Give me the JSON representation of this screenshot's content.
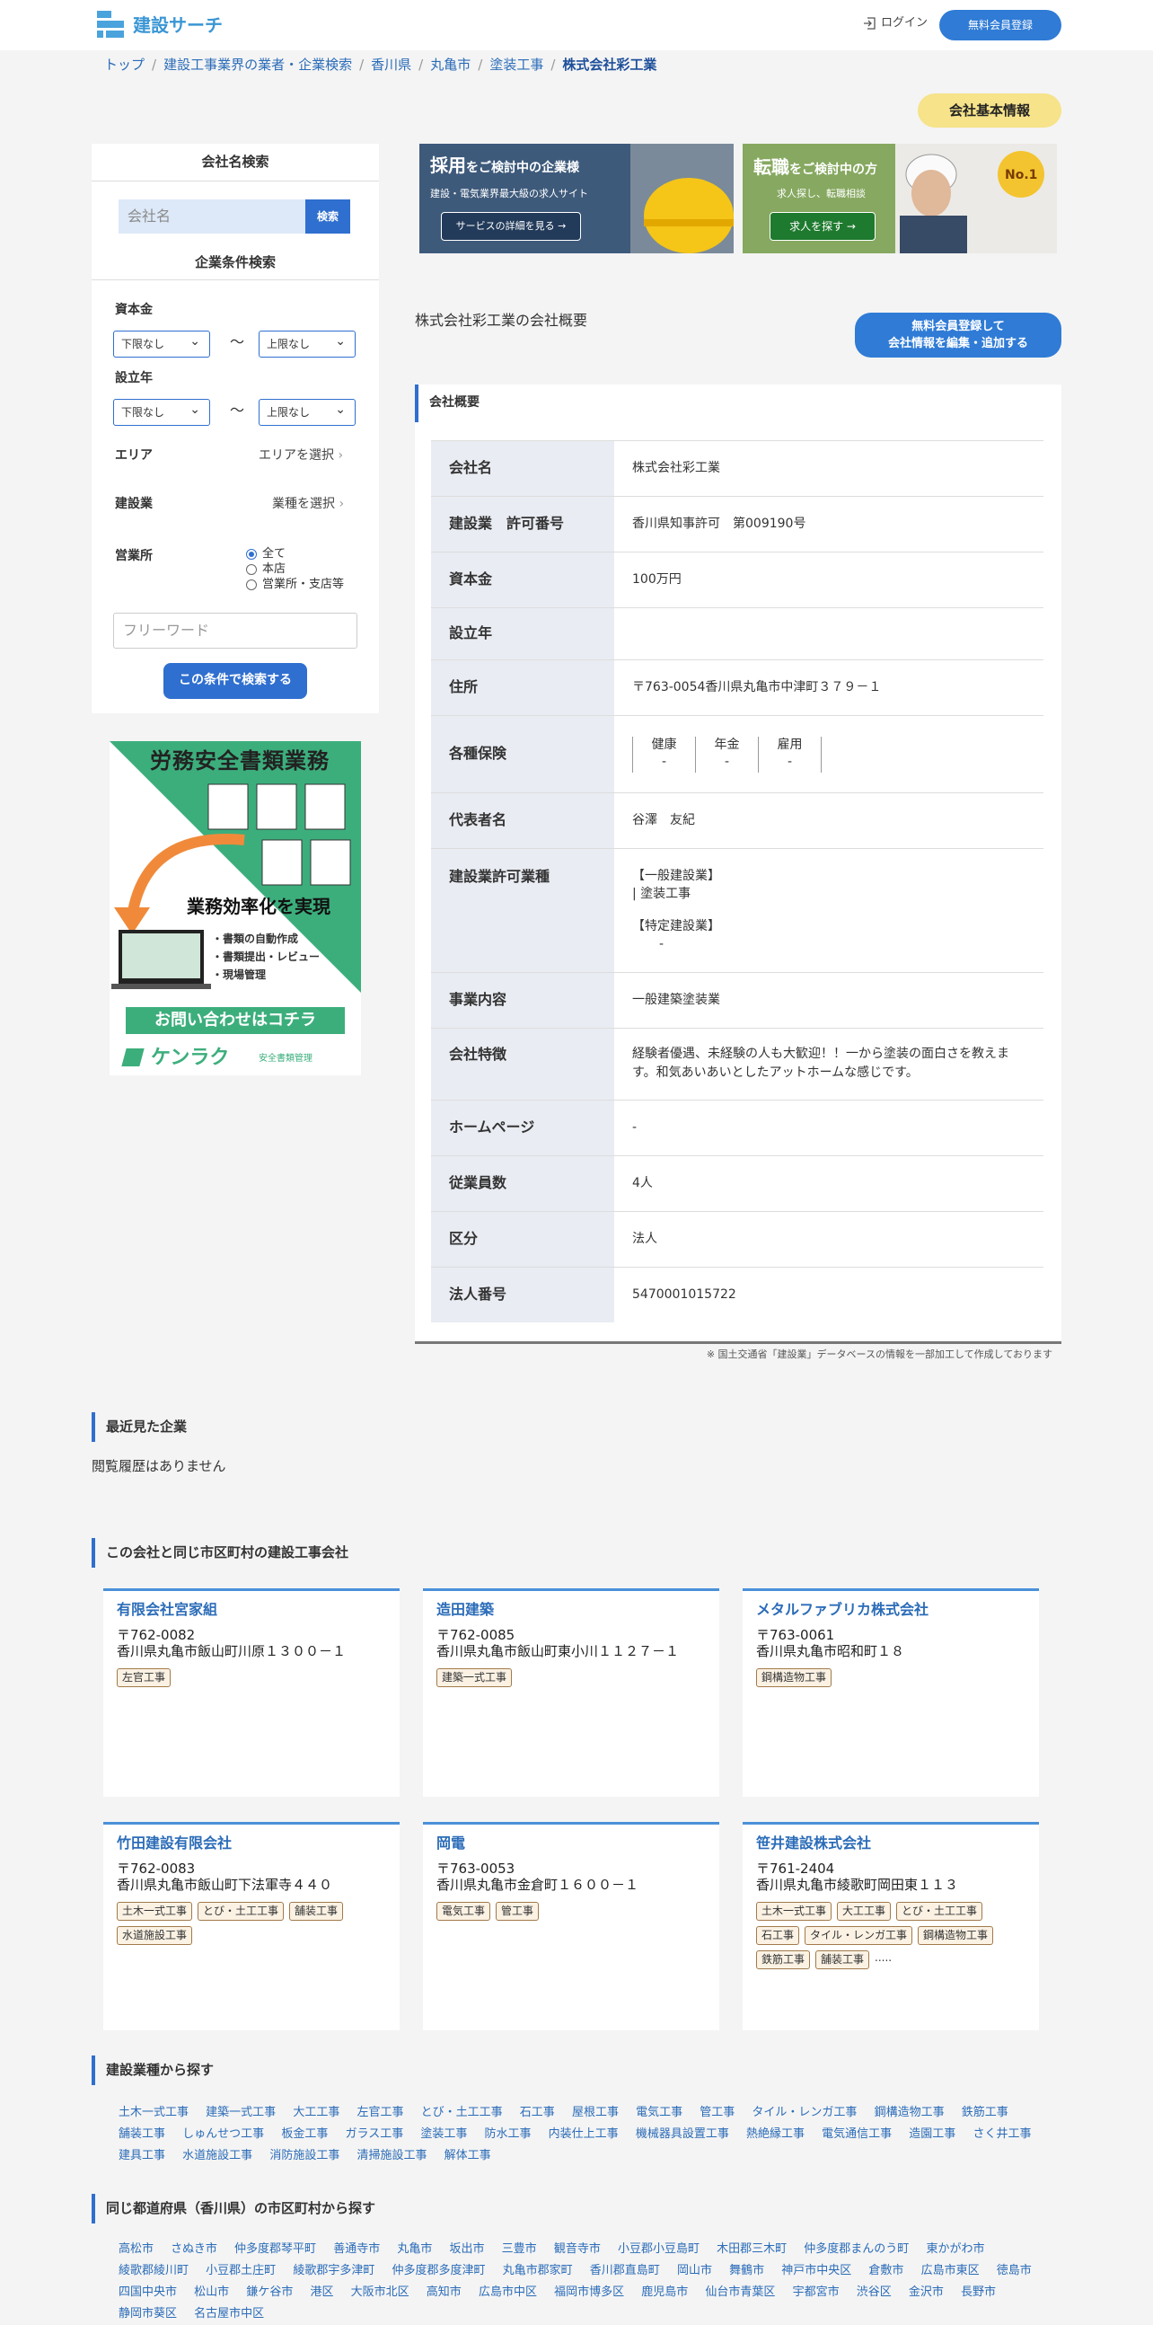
{
  "header": {
    "logo_text": "建設サーチ",
    "login": "ログイン",
    "signup": "無料会員登録"
  },
  "breadcrumb": [
    "トップ",
    "建設工事業界の業者・企業検索",
    "香川県",
    "丸亀市",
    "塗装工事",
    "株式会社彩工業"
  ],
  "basic_info_badge": "会社基本情報",
  "sidebar": {
    "name_search_title": "会社名検索",
    "name_placeholder": "会社名",
    "search_btn": "検索",
    "cond_title": "企業条件検索",
    "capital_label": "資本金",
    "year_label": "設立年",
    "lower_none": "下限なし",
    "upper_none": "上限なし",
    "tilde": "〜",
    "area_label": "エリア",
    "area_pick": "エリアを選択",
    "trade_label": "建設業",
    "trade_pick": "業種を選択",
    "office_label": "営業所",
    "office_options": [
      "全て",
      "本店",
      "営業所・支店等"
    ],
    "free_placeholder": "フリーワード",
    "cond_btn": "この条件で検索する"
  },
  "ad": {
    "title": "労務安全書類業務",
    "headline": "業務効率化を実現",
    "bullets": [
      "・書類の自動作成",
      "・書類提出・レビュー",
      "・現場管理"
    ],
    "cta": "お問い合わせはコチラ",
    "brand": "ケンラク",
    "brand_sub": "安全書類管理"
  },
  "banners": {
    "b1_title_big": "採用",
    "b1_title": "をご検討中の企業様",
    "b1_sub": "建設・電気業界最大級の求人サイト",
    "b1_btn": "サービスの詳細を見る →",
    "b2_title_big": "転職",
    "b2_title": "をご検討中の方",
    "b2_sub": "求人探し、転職相談",
    "b2_btn": "求人を探す →",
    "b2_badge": "No.1"
  },
  "overview_title": "株式会社彩工業の会社概要",
  "edit_btn": [
    "無料会員登録して",
    "会社情報を編集・追加する"
  ],
  "summary_head": "会社概要",
  "table": [
    {
      "k": "会社名",
      "v": "株式会社彩工業"
    },
    {
      "k": "建設業　許可番号",
      "v": "香川県知事許可　第009190号"
    },
    {
      "k": "資本金",
      "v": "100万円"
    },
    {
      "k": "設立年",
      "v": ""
    },
    {
      "k": "住所",
      "v": "〒763-0054香川県丸亀市中津町３７９－１"
    },
    {
      "k": "各種保険",
      "v": ""
    },
    {
      "k": "代表者名",
      "v": "谷澤　友紀"
    },
    {
      "k": "建設業許可業種",
      "v": ""
    },
    {
      "k": "事業内容",
      "v": "一般建築塗装業"
    },
    {
      "k": "会社特徴",
      "v": "経験者優遇、未経験の人も大歓迎！！一から塗装の面白さを教えます。和気あいあいとしたアットホームな感じです。"
    },
    {
      "k": "ホームページ",
      "v": "-"
    },
    {
      "k": "従業員数",
      "v": "4人"
    },
    {
      "k": "区分",
      "v": "法人"
    },
    {
      "k": "法人番号",
      "v": "5470001015722"
    }
  ],
  "insurance": [
    {
      "n": "健康",
      "v": "-"
    },
    {
      "n": "年金",
      "v": "-"
    },
    {
      "n": "雇用",
      "v": "-"
    }
  ],
  "permit": {
    "general": "【一般建設業】",
    "general_item": "| 塗装工事",
    "special": "【特定建設業】",
    "special_item": "-"
  },
  "source_note": "※ 国土交通省「建設業」データベースの情報を一部加工して作成しております",
  "recent": {
    "title": "最近見た企業",
    "empty": "閲覧履歴はありません"
  },
  "same_city": {
    "title": "この会社と同じ市区町村の建設工事会社",
    "cards": [
      {
        "name": "有限会社宮家組",
        "zip": "〒762-0082",
        "addr": "香川県丸亀市飯山町川原１３００－１",
        "tags": [
          "左官工事"
        ],
        "more": ""
      },
      {
        "name": "造田建築",
        "zip": "〒762-0085",
        "addr": "香川県丸亀市飯山町東小川１１２７－１",
        "tags": [
          "建築一式工事"
        ],
        "more": ""
      },
      {
        "name": "メタルファブリカ株式会社",
        "zip": "〒763-0061",
        "addr": "香川県丸亀市昭和町１８",
        "tags": [
          "鋼構造物工事"
        ],
        "more": ""
      },
      {
        "name": "竹田建設有限会社",
        "zip": "〒762-0083",
        "addr": "香川県丸亀市飯山町下法軍寺４４０",
        "tags": [
          "土木一式工事",
          "とび・土工工事",
          "舗装工事",
          "水道施設工事"
        ],
        "more": ""
      },
      {
        "name": "岡電",
        "zip": "〒763-0053",
        "addr": "香川県丸亀市金倉町１６００－１",
        "tags": [
          "電気工事",
          "管工事"
        ],
        "more": ""
      },
      {
        "name": "笹井建設株式会社",
        "zip": "〒761-2404",
        "addr": "香川県丸亀市綾歌町岡田東１１３",
        "tags": [
          "土木一式工事",
          "大工工事",
          "とび・土工工事",
          "石工事",
          "タイル・レンガ工事",
          "鋼構造物工事",
          "鉄筋工事",
          "舗装工事"
        ],
        "more": "....."
      }
    ]
  },
  "trades": {
    "title": "建設業種から探す",
    "items": [
      "土木一式工事",
      "建築一式工事",
      "大工工事",
      "左官工事",
      "とび・土工工事",
      "石工事",
      "屋根工事",
      "電気工事",
      "管工事",
      "タイル・レンガ工事",
      "鋼構造物工事",
      "鉄筋工事",
      "舗装工事",
      "しゅんせつ工事",
      "板金工事",
      "ガラス工事",
      "塗装工事",
      "防水工事",
      "内装仕上工事",
      "機械器具設置工事",
      "熱絶縁工事",
      "電気通信工事",
      "造園工事",
      "さく井工事",
      "建具工事",
      "水道施設工事",
      "消防施設工事",
      "清掃施設工事",
      "解体工事"
    ]
  },
  "cities": {
    "title": "同じ都道府県（香川県）の市区町村から探す",
    "items": [
      "高松市",
      "さぬき市",
      "仲多度郡琴平町",
      "善通寺市",
      "丸亀市",
      "坂出市",
      "三豊市",
      "観音寺市",
      "小豆郡小豆島町",
      "木田郡三木町",
      "仲多度郡まんのう町",
      "東かがわ市",
      "綾歌郡綾川町",
      "小豆郡土庄町",
      "綾歌郡宇多津町",
      "仲多度郡多度津町",
      "丸亀市郡家町",
      "香川郡直島町",
      "岡山市",
      "舞鶴市",
      "神戸市中央区",
      "倉敷市",
      "広島市東区",
      "徳島市",
      "四国中央市",
      "松山市",
      "鎌ケ谷市",
      "港区",
      "大阪市北区",
      "高知市",
      "広島市中区",
      "福岡市博多区",
      "鹿児島市",
      "仙台市青葉区",
      "宇都宮市",
      "渋谷区",
      "金沢市",
      "長野市",
      "静岡市葵区",
      "名古屋市中区"
    ]
  }
}
